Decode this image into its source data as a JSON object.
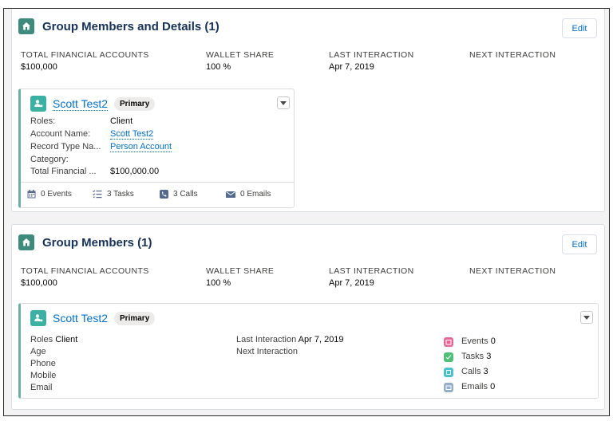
{
  "section1": {
    "title": "Group Members and Details (1)",
    "edit_label": "Edit",
    "stats": [
      {
        "label": "TOTAL FINANCIAL ACCOUNTS",
        "value": "$100,000"
      },
      {
        "label": "WALLET SHARE",
        "value": "100 %"
      },
      {
        "label": "LAST INTERACTION",
        "value": "Apr 7, 2019"
      },
      {
        "label": "NEXT INTERACTION",
        "value": ""
      }
    ],
    "card": {
      "name": "Scott Test2",
      "badge": "Primary",
      "fields": [
        {
          "label": "Roles:",
          "value": "Client"
        },
        {
          "label": "Account Name:",
          "value": "Scott Test2"
        },
        {
          "label": "Record Type Na...",
          "value": "Person Account"
        },
        {
          "label": "Category:",
          "value": ""
        },
        {
          "label": "Total Financial ...",
          "value": "$100,000.00"
        }
      ],
      "footer": {
        "events": "0 Events",
        "tasks": "3 Tasks",
        "calls": "3 Calls",
        "emails": "0 Emails"
      }
    }
  },
  "section2": {
    "title": "Group Members (1)",
    "edit_label": "Edit",
    "stats": [
      {
        "label": "TOTAL FINANCIAL ACCOUNTS",
        "value": "$100,000"
      },
      {
        "label": "WALLET SHARE",
        "value": "100 %"
      },
      {
        "label": "LAST INTERACTION",
        "value": "Apr 7, 2019"
      },
      {
        "label": "NEXT INTERACTION",
        "value": ""
      }
    ],
    "card": {
      "name": "Scott Test2",
      "badge": "Primary",
      "left": {
        "roles_label": "Roles",
        "roles_value": "Client",
        "age_label": "Age",
        "phone_label": "Phone",
        "mobile_label": "Mobile",
        "email_label": "Email"
      },
      "mid": {
        "last_label": "Last Interaction",
        "last_value": "Apr 7, 2019",
        "next_label": "Next Interaction"
      },
      "activity": {
        "events_label": "Events",
        "events_value": "0",
        "tasks_label": "Tasks",
        "tasks_value": "3",
        "calls_label": "Calls",
        "calls_value": "3",
        "emails_label": "Emails",
        "emails_value": "0"
      }
    }
  },
  "colors": {
    "accent_link": "#0070d2",
    "group_icon": "#3e8a7c",
    "person_icon": "#3cb0a3",
    "card_border": "#69b0a4",
    "events_icon": "#e56798",
    "tasks_icon": "#4bc076",
    "calls_icon": "#48c3cc",
    "emails_icon": "#95aec5"
  }
}
